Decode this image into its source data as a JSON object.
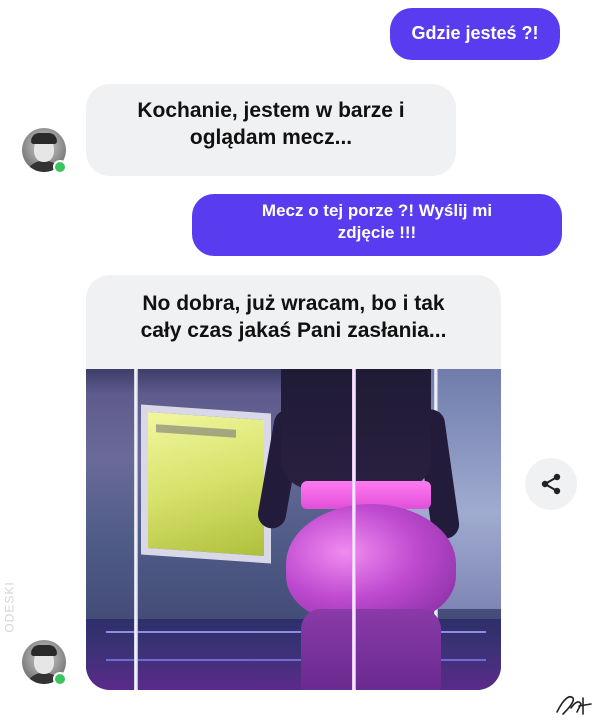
{
  "messages": [
    {
      "direction": "outgoing",
      "text": "Gdzie jesteś ?!"
    },
    {
      "direction": "incoming",
      "lines": [
        "Kochanie, jestem w barze i",
        "oglądam mecz..."
      ]
    },
    {
      "direction": "outgoing",
      "lines": [
        "Mecz o tej porze ?! Wyślij mi",
        "zdjęcie !!!"
      ]
    },
    {
      "direction": "incoming",
      "lines": [
        "No dobra, już wracam, bo i tak",
        "cały czas jakaś Pani zasłania..."
      ],
      "has_photo": true
    }
  ],
  "watermark": "ODESKI",
  "colors": {
    "outgoing_bubble": "#5a3cf0",
    "incoming_bubble": "#f0f1f3",
    "online_indicator": "#3bc55e"
  },
  "icons": {
    "share": "share-icon",
    "avatar": "avatar",
    "online": "online-dot"
  }
}
